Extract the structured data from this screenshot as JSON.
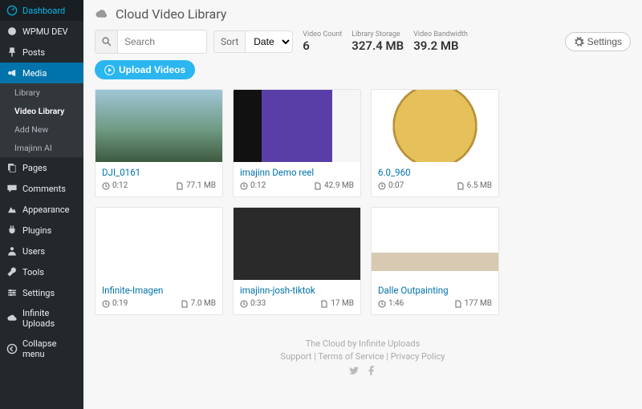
{
  "sidebar": {
    "items": [
      {
        "label": "Dashboard",
        "icon": "dashboard-icon"
      },
      {
        "label": "WPMU DEV",
        "icon": "wpmudev-icon"
      },
      {
        "label": "Posts",
        "icon": "pin-icon"
      },
      {
        "label": "Media",
        "icon": "media-icon",
        "active": true
      },
      {
        "label": "Pages",
        "icon": "pages-icon"
      },
      {
        "label": "Comments",
        "icon": "comments-icon"
      },
      {
        "label": "Appearance",
        "icon": "appearance-icon"
      },
      {
        "label": "Plugins",
        "icon": "plugins-icon"
      },
      {
        "label": "Users",
        "icon": "users-icon"
      },
      {
        "label": "Tools",
        "icon": "tools-icon"
      },
      {
        "label": "Settings",
        "icon": "settings-icon"
      },
      {
        "label": "Infinite Uploads",
        "icon": "cloud-icon"
      },
      {
        "label": "Collapse menu",
        "icon": "collapse-icon"
      }
    ],
    "media_sub": [
      {
        "label": "Library"
      },
      {
        "label": "Video Library",
        "selected": true
      },
      {
        "label": "Add New"
      },
      {
        "label": "Imajinn AI"
      }
    ]
  },
  "header": {
    "title": "Cloud Video Library"
  },
  "toolbar": {
    "search_placeholder": "Search",
    "sort_label": "Sort",
    "sort_value": "Date",
    "stats": [
      {
        "label": "Video Count",
        "value": "6"
      },
      {
        "label": "Library Storage",
        "value": "327.4 MB"
      },
      {
        "label": "Video Bandwidth",
        "value": "39.2 MB"
      }
    ],
    "settings_label": "Settings",
    "upload_label": "Upload Videos"
  },
  "videos": [
    {
      "title": "DJI_0161",
      "duration": "0:12",
      "size": "77.1 MB",
      "thumb_css": "linear-gradient(180deg,#9fc6d6 0%,#6f9a83 55%,#3e5a3f 100%)"
    },
    {
      "title": "imajinn Demo reel",
      "duration": "0:12",
      "size": "42.9 MB",
      "thumb_css": "linear-gradient(90deg,#111 0 22%,#5a3ea8 22% 78%,#f5f5f5 78% 100%)"
    },
    {
      "title": "6.0_960",
      "duration": "0:07",
      "size": "6.5 MB",
      "thumb_css": "radial-gradient(circle at 50% 50%, #e6c05a 0 55%, #b8923a 55% 58%, #fff 58% 100%)"
    },
    {
      "title": "Infinite-Imagen",
      "duration": "0:19",
      "size": "7.0 MB",
      "thumb_css": "linear-gradient(#fff,#fff)"
    },
    {
      "title": "imajinn-josh-tiktok",
      "duration": "0:33",
      "size": "17 MB",
      "thumb_css": "linear-gradient(180deg,#2a2a2a 0 100%)"
    },
    {
      "title": "Dalle Outpainting",
      "duration": "1:46",
      "size": "177 MB",
      "thumb_css": "linear-gradient(180deg,#fff 0 62%, #d7c9b2 62% 88%, #fff 88% 100%)"
    }
  ],
  "footer": {
    "tagline": "The Cloud by Infinite Uploads",
    "links": [
      "Support",
      "Terms of Service",
      "Privacy Policy"
    ],
    "sep": " | "
  }
}
